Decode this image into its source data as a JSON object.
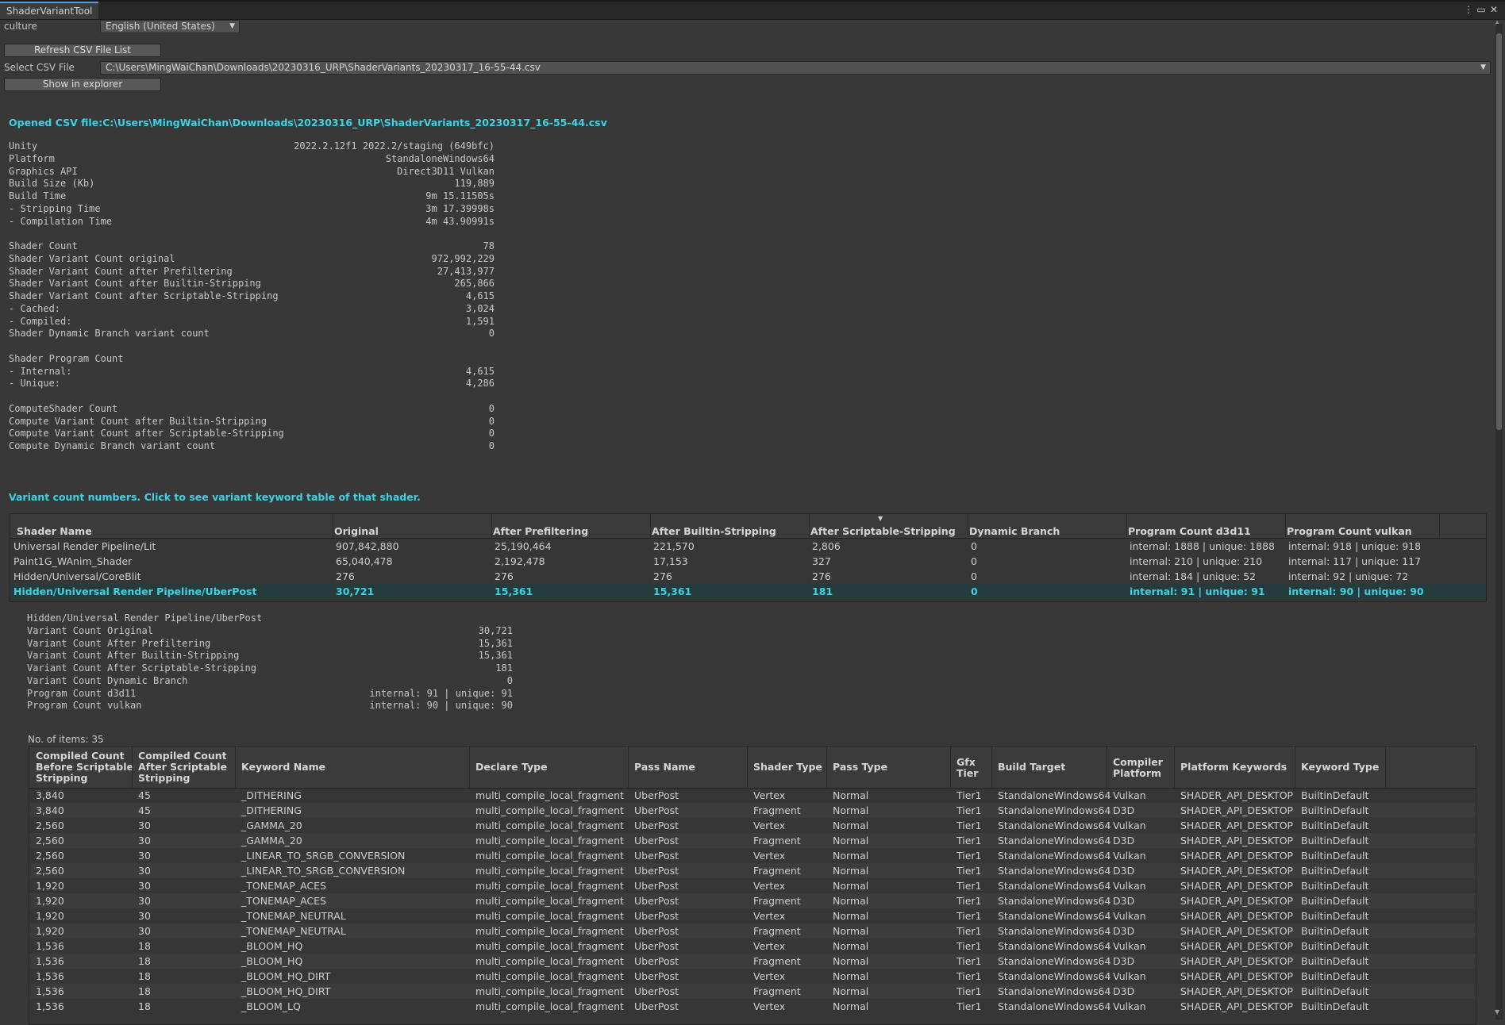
{
  "window": {
    "tab_title": "ShaderVariantTool"
  },
  "toolbar": {
    "culture_label": "culture",
    "culture_value": "English (United States)",
    "refresh_label": "Refresh CSV File List",
    "select_csv_label": "Select CSV File",
    "csv_path": "C:\\Users\\MingWaiChan\\Downloads\\20230316_URP\\ShaderVariants_20230317_16-55-44.csv",
    "show_explorer_label": "Show in explorer"
  },
  "opened_message": "Opened CSV file:C:\\Users\\MingWaiChan\\Downloads\\20230316_URP\\ShaderVariants_20230317_16-55-44.csv",
  "report": [
    {
      "k": "Unity",
      "v": "2022.2.12f1 2022.2/staging (649bfc)"
    },
    {
      "k": "Platform",
      "v": "StandaloneWindows64"
    },
    {
      "k": "Graphics API",
      "v": "Direct3D11 Vulkan"
    },
    {
      "k": "Build Size (Kb)",
      "v": "119,889"
    },
    {
      "k": "Build Time",
      "v": "9m 15.11505s"
    },
    {
      "k": "- Stripping Time",
      "v": "3m 17.39998s"
    },
    {
      "k": "- Compilation Time",
      "v": "4m 43.90991s"
    },
    {
      "k": "",
      "v": ""
    },
    {
      "k": "Shader Count",
      "v": "78"
    },
    {
      "k": "Shader Variant Count original",
      "v": "972,992,229"
    },
    {
      "k": "Shader Variant Count after Prefiltering",
      "v": "27,413,977"
    },
    {
      "k": "Shader Variant Count after Builtin-Stripping",
      "v": "265,866"
    },
    {
      "k": "Shader Variant Count after Scriptable-Stripping",
      "v": "4,615"
    },
    {
      "k": "- Cached:",
      "v": "3,024"
    },
    {
      "k": "- Compiled:",
      "v": "1,591"
    },
    {
      "k": "Shader Dynamic Branch variant count",
      "v": "0"
    },
    {
      "k": "",
      "v": ""
    },
    {
      "k": "Shader Program Count",
      "v": ""
    },
    {
      "k": "- Internal:",
      "v": "4,615"
    },
    {
      "k": "- Unique:",
      "v": "4,286"
    },
    {
      "k": "",
      "v": ""
    },
    {
      "k": "ComputeShader Count",
      "v": "0"
    },
    {
      "k": "Compute Variant Count after Builtin-Stripping",
      "v": "0"
    },
    {
      "k": "Compute Variant Count after Scriptable-Stripping",
      "v": "0"
    },
    {
      "k": "Compute Dynamic Branch variant count",
      "v": "0"
    }
  ],
  "variant_hint": "Variant count numbers. Click to see variant keyword table of that shader.",
  "shader_table": {
    "headers": [
      "Shader Name",
      "Original",
      "After Prefiltering",
      "After Builtin-Stripping",
      "After Scriptable-Stripping",
      "Dynamic Branch",
      "Program Count d3d11",
      "Program Count vulkan"
    ],
    "rows": [
      [
        "Universal Render Pipeline/Lit",
        "907,842,880",
        "25,190,464",
        "221,570",
        "2,806",
        "0",
        "internal: 1888 | unique: 1888",
        "internal: 918 | unique: 918"
      ],
      [
        "Paint1G_WAnim_Shader",
        "65,040,478",
        "2,192,478",
        "17,153",
        "327",
        "0",
        "internal: 210 | unique: 210",
        "internal: 117 | unique: 117"
      ],
      [
        "Hidden/Universal/CoreBlit",
        "276",
        "276",
        "276",
        "276",
        "0",
        "internal: 184 | unique: 52",
        "internal: 92 | unique: 72"
      ],
      [
        "Hidden/Universal Render Pipeline/UberPost",
        "30,721",
        "15,361",
        "15,361",
        "181",
        "0",
        "internal: 91 | unique: 91",
        "internal: 90 | unique: 90"
      ]
    ]
  },
  "detail": {
    "title": "Hidden/Universal Render Pipeline/UberPost",
    "rows": [
      {
        "k": "Variant Count Original",
        "v": "30,721"
      },
      {
        "k": "Variant Count After Prefiltering",
        "v": "15,361"
      },
      {
        "k": "Variant Count After Builtin-Stripping",
        "v": "15,361"
      },
      {
        "k": "Variant Count After Scriptable-Stripping",
        "v": "181"
      },
      {
        "k": "Variant Count Dynamic Branch",
        "v": "0"
      },
      {
        "k": "Program Count d3d11",
        "v": "internal: 91 | unique: 91"
      },
      {
        "k": "Program Count vulkan",
        "v": "internal: 90 | unique: 90"
      }
    ],
    "items_count": "No. of items: 35"
  },
  "variant_table": {
    "headers": [
      [
        "Compiled Count",
        "Before Scriptable",
        "Stripping"
      ],
      [
        "Compiled Count",
        "After Scriptable",
        "Stripping"
      ],
      [
        "Keyword Name"
      ],
      [
        "Declare Type"
      ],
      [
        "Pass Name"
      ],
      [
        "Shader Type"
      ],
      [
        "Pass Type"
      ],
      [
        "Gfx",
        "Tier"
      ],
      [
        "Build Target"
      ],
      [
        "Compiler",
        "Platform"
      ],
      [
        "Platform Keywords"
      ],
      [
        "Keyword Type"
      ]
    ],
    "rows": [
      [
        "3,840",
        "45",
        "_DITHERING",
        "multi_compile_local_fragment",
        "UberPost",
        "Vertex",
        "Normal",
        "Tier1",
        "StandaloneWindows64",
        "Vulkan",
        "SHADER_API_DESKTOP",
        "BuiltinDefault"
      ],
      [
        "3,840",
        "45",
        "_DITHERING",
        "multi_compile_local_fragment",
        "UberPost",
        "Fragment",
        "Normal",
        "Tier1",
        "StandaloneWindows64",
        "D3D",
        "SHADER_API_DESKTOP",
        "BuiltinDefault"
      ],
      [
        "2,560",
        "30",
        "_GAMMA_20",
        "multi_compile_local_fragment",
        "UberPost",
        "Vertex",
        "Normal",
        "Tier1",
        "StandaloneWindows64",
        "Vulkan",
        "SHADER_API_DESKTOP",
        "BuiltinDefault"
      ],
      [
        "2,560",
        "30",
        "_GAMMA_20",
        "multi_compile_local_fragment",
        "UberPost",
        "Fragment",
        "Normal",
        "Tier1",
        "StandaloneWindows64",
        "D3D",
        "SHADER_API_DESKTOP",
        "BuiltinDefault"
      ],
      [
        "2,560",
        "30",
        "_LINEAR_TO_SRGB_CONVERSION",
        "multi_compile_local_fragment",
        "UberPost",
        "Vertex",
        "Normal",
        "Tier1",
        "StandaloneWindows64",
        "Vulkan",
        "SHADER_API_DESKTOP",
        "BuiltinDefault"
      ],
      [
        "2,560",
        "30",
        "_LINEAR_TO_SRGB_CONVERSION",
        "multi_compile_local_fragment",
        "UberPost",
        "Fragment",
        "Normal",
        "Tier1",
        "StandaloneWindows64",
        "D3D",
        "SHADER_API_DESKTOP",
        "BuiltinDefault"
      ],
      [
        "1,920",
        "30",
        "_TONEMAP_ACES",
        "multi_compile_local_fragment",
        "UberPost",
        "Vertex",
        "Normal",
        "Tier1",
        "StandaloneWindows64",
        "Vulkan",
        "SHADER_API_DESKTOP",
        "BuiltinDefault"
      ],
      [
        "1,920",
        "30",
        "_TONEMAP_ACES",
        "multi_compile_local_fragment",
        "UberPost",
        "Fragment",
        "Normal",
        "Tier1",
        "StandaloneWindows64",
        "D3D",
        "SHADER_API_DESKTOP",
        "BuiltinDefault"
      ],
      [
        "1,920",
        "30",
        "_TONEMAP_NEUTRAL",
        "multi_compile_local_fragment",
        "UberPost",
        "Vertex",
        "Normal",
        "Tier1",
        "StandaloneWindows64",
        "Vulkan",
        "SHADER_API_DESKTOP",
        "BuiltinDefault"
      ],
      [
        "1,920",
        "30",
        "_TONEMAP_NEUTRAL",
        "multi_compile_local_fragment",
        "UberPost",
        "Fragment",
        "Normal",
        "Tier1",
        "StandaloneWindows64",
        "D3D",
        "SHADER_API_DESKTOP",
        "BuiltinDefault"
      ],
      [
        "1,536",
        "18",
        "_BLOOM_HQ",
        "multi_compile_local_fragment",
        "UberPost",
        "Vertex",
        "Normal",
        "Tier1",
        "StandaloneWindows64",
        "Vulkan",
        "SHADER_API_DESKTOP",
        "BuiltinDefault"
      ],
      [
        "1,536",
        "18",
        "_BLOOM_HQ",
        "multi_compile_local_fragment",
        "UberPost",
        "Fragment",
        "Normal",
        "Tier1",
        "StandaloneWindows64",
        "D3D",
        "SHADER_API_DESKTOP",
        "BuiltinDefault"
      ],
      [
        "1,536",
        "18",
        "_BLOOM_HQ_DIRT",
        "multi_compile_local_fragment",
        "UberPost",
        "Vertex",
        "Normal",
        "Tier1",
        "StandaloneWindows64",
        "Vulkan",
        "SHADER_API_DESKTOP",
        "BuiltinDefault"
      ],
      [
        "1,536",
        "18",
        "_BLOOM_HQ_DIRT",
        "multi_compile_local_fragment",
        "UberPost",
        "Fragment",
        "Normal",
        "Tier1",
        "StandaloneWindows64",
        "D3D",
        "SHADER_API_DESKTOP",
        "BuiltinDefault"
      ],
      [
        "1,536",
        "18",
        "_BLOOM_LQ",
        "multi_compile_local_fragment",
        "UberPost",
        "Vertex",
        "Normal",
        "Tier1",
        "StandaloneWindows64",
        "Vulkan",
        "SHADER_API_DESKTOP",
        "BuiltinDefault"
      ]
    ]
  },
  "icons": {
    "menu": "kebab-menu-icon",
    "maximize": "maximize-icon",
    "close": "close-icon",
    "dropdown": "chevron-down-icon",
    "sort": "sort-descending-icon"
  },
  "colors": {
    "accent_cyan": "#3fd2e2",
    "background": "#383838",
    "selected_row": "#253b3c"
  }
}
